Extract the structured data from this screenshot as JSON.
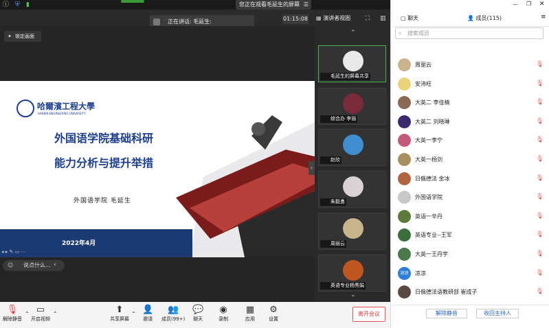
{
  "window": {
    "viewing_banner": "您正在观看毛延生的屏幕",
    "speaker_label": "正在讲话: 毛延生:",
    "clock": "01:15:08",
    "view_mode": "演讲者视图"
  },
  "stage": {
    "lock_label": "锁定画面",
    "chat_placeholder": "说点什么...",
    "slide": {
      "university": "哈爾濱工程大學",
      "university_en": "HARBIN ENGINEERING UNIVERSITY",
      "title_line1": "外国语学院基础科研",
      "title_line2": "能力分析与提升举措",
      "author": "外国语学院   毛延生",
      "date": "2022年4月"
    }
  },
  "tiles": [
    {
      "name": "毛延生的屏幕共享",
      "color": "#d8d8d8"
    },
    {
      "name": "综合办 李丽",
      "color": "#7a2b3b"
    },
    {
      "name": "赵欣",
      "color": "#3f8fd0"
    },
    {
      "name": "朱毅勇",
      "color": "#d9d2d4"
    },
    {
      "name": "周丽云",
      "color": "#c9b48c"
    },
    {
      "name": "英语专业杨秀娟",
      "color": "#c0561f"
    }
  ],
  "toolbar": {
    "mute": "解除静音",
    "video": "开启视频",
    "share": "共享屏幕",
    "invite": "邀请",
    "members": "成员(99+)",
    "chat": "聊天",
    "record": "录制",
    "apps": "应用",
    "settings": "设置",
    "leave": "离开会议"
  },
  "panel": {
    "tab_chat": "聊天",
    "tab_members": "成员(115)",
    "search_placeholder": "搜索成员",
    "members": [
      {
        "name": "周丽云",
        "color": "#c9b48c"
      },
      {
        "name": "安沛旺",
        "color": "#e8d27a"
      },
      {
        "name": "大英二 李佳楠",
        "color": "#8a6a55"
      },
      {
        "name": "大英二 刘晓琳",
        "color": "#3d2a6e"
      },
      {
        "name": "大英一李宁",
        "color": "#c45a7a"
      },
      {
        "name": "大英一杨剑",
        "color": "#a88f60"
      },
      {
        "name": "日俄德法 金冰",
        "color": "#b06440"
      },
      {
        "name": "外国语学院",
        "color": "#c8c8c8"
      },
      {
        "name": "英语一辛丹",
        "color": "#5a7a3a"
      },
      {
        "name": "英语专业--王军",
        "color": "#3a6e3a"
      },
      {
        "name": "大英一王丹宇",
        "color": "#4a7a4a"
      },
      {
        "name": "凉凉",
        "color": "#2f7fd6",
        "initials": "凉凉"
      },
      {
        "name": "日俄德法语教研部 崔成子",
        "color": "#5a4a44"
      }
    ],
    "unmute_all": "解除静音",
    "reclaim_host": "收回主持人"
  },
  "colors": {
    "accent": "#2b63c0",
    "danger": "#e03c3c",
    "slide_blue": "#1b3e8f"
  }
}
